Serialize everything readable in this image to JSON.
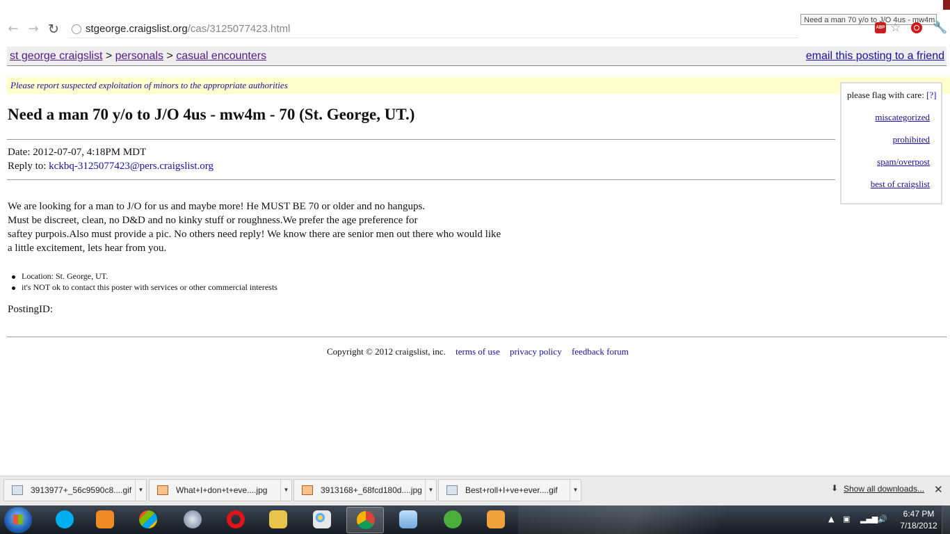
{
  "browser": {
    "url_host": "stgeorge.craigslist.org",
    "url_path": "/cas/3125077423.html",
    "tooltip": "Need a man 70 y/o to J/O 4us - mw4m",
    "icons": [
      "back-arrow",
      "forward-arrow",
      "reload",
      "page",
      "adblock",
      "star",
      "stop",
      "wrench"
    ]
  },
  "breadcrumb": {
    "site": "st george craigslist",
    "sep1": " > ",
    "section": "personals",
    "sep2": " > ",
    "category": "casual encounters",
    "email_link": "email this posting to a friend"
  },
  "warning": "Please report suspected exploitation of minors to the appropriate authorities",
  "post": {
    "title": "Need a man 70 y/o to J/O 4us - mw4m - 70 (St. George, UT.)",
    "date_label": "Date: ",
    "date": "2012-07-07, 4:18PM MDT",
    "reply_label": "Reply to: ",
    "reply_email": "kckbq-3125077423@pers.craigslist.org",
    "body_lines": [
      "We are looking for a man to J/O for us and maybe more! He MUST BE 70 or older and no hangups.",
      "Must be discreet, clean, no D&D and no kinky stuff or roughness.We prefer the age preference for",
      "saftey purpois.Also must provide a pic. No others need reply! We know there are senior men out there who would like",
      "a little excitement, lets hear from you."
    ],
    "bullets": [
      "Location: St. George, UT.",
      "it's NOT ok to contact this poster with services or other commercial interests"
    ],
    "posting_id_label": "PostingID:"
  },
  "flag_box": {
    "title": "please flag with care: ",
    "help": "[?]",
    "links": [
      "miscategorized",
      "prohibited",
      "spam/overpost",
      "best of craigslist"
    ]
  },
  "footer": {
    "copyright": "Copyright © 2012 craigslist, inc.",
    "links": [
      "terms of use",
      "privacy policy",
      "feedback forum"
    ]
  },
  "downloads": {
    "items": [
      "3913977+_56c9590c8....gif",
      "What+I+don+t+eve....jpg",
      "3913168+_68fcd180d....jpg",
      "Best+roll+I+ve+ever....gif"
    ],
    "show_all": "Show all downloads...",
    "close": "✕"
  },
  "taskbar": {
    "apps": [
      "skype",
      "media-player",
      "windows-explorer-media",
      "quicktime",
      "opera",
      "file-explorer",
      "paint",
      "chrome",
      "notepad",
      "utorrent",
      "image-viewer"
    ],
    "time": "6:47 PM",
    "date": "7/18/2012"
  }
}
